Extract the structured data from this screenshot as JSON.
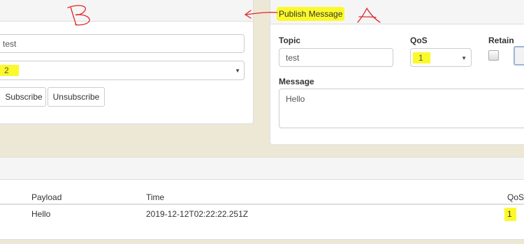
{
  "subscribe_panel": {
    "topic_value": "test",
    "qos_value": "2",
    "subscribe_label": "Subscribe",
    "unsubscribe_label": "Unsubscribe"
  },
  "publish_panel": {
    "title": "Publish Message",
    "topic_label": "Topic",
    "topic_value": "test",
    "qos_label": "QoS",
    "qos_value": "1",
    "retain_label": "Retain",
    "retain_checked": false,
    "message_label": "Message",
    "message_value": "Hello"
  },
  "messages_table": {
    "columns": [
      "Payload",
      "Time",
      "QoS"
    ],
    "rows": [
      {
        "payload": "Hello",
        "time": "2019-12-12T02:22:22.251Z",
        "qos": "1"
      }
    ]
  },
  "annotations": {
    "label_a": "A",
    "label_b": "B",
    "arrow_color": "#e0262a"
  },
  "colors": {
    "highlight": "#fbf92a",
    "background": "#ede8d5"
  }
}
